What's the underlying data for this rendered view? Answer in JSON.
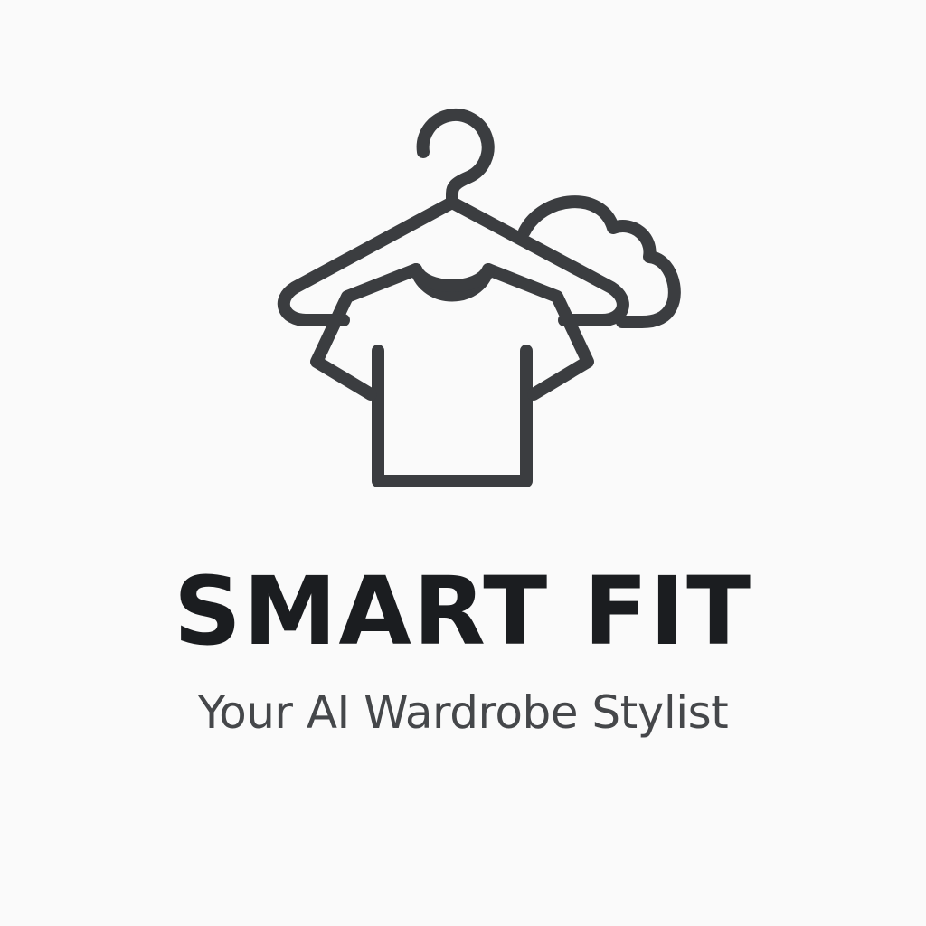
{
  "brand": {
    "title": "SMART FIT",
    "tagline": "Your AI Wardrobe Stylist"
  },
  "colors": {
    "background": "#fafafa",
    "icon_stroke": "#3b3d40",
    "title": "#1b1d20",
    "tagline": "#45474a"
  },
  "icons": [
    "hanger-icon",
    "tshirt-icon",
    "cloud-icon"
  ]
}
